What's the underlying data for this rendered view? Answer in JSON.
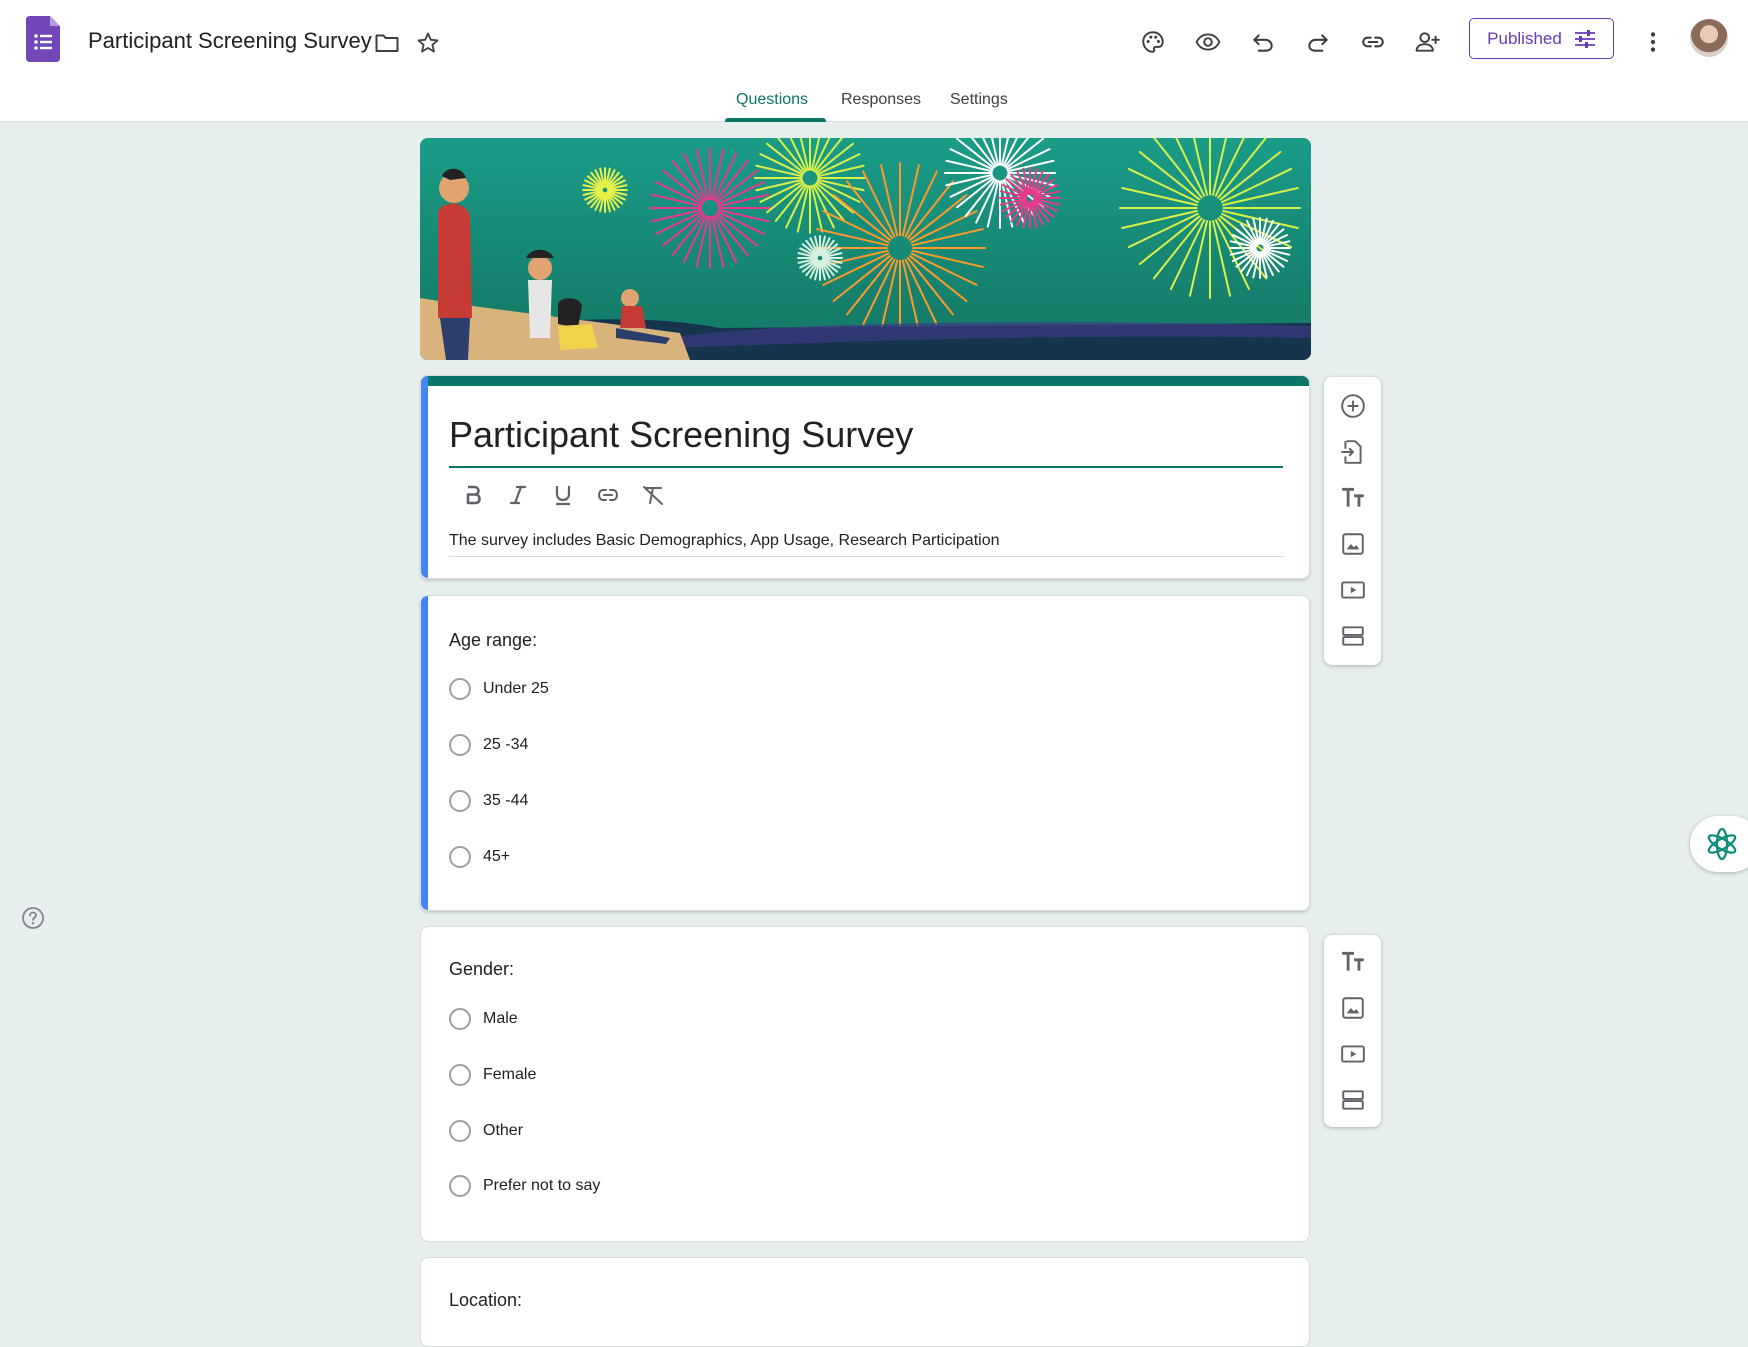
{
  "header": {
    "doc_title": "Participant Screening Survey",
    "publish_label": "Published"
  },
  "tabs": [
    {
      "label": "Questions",
      "active": true
    },
    {
      "label": "Responses",
      "active": false
    },
    {
      "label": "Settings",
      "active": false
    }
  ],
  "form": {
    "title": "Participant Screening Survey",
    "description": "The survey includes Basic Demographics, App Usage, Research Participation"
  },
  "questions": [
    {
      "title": "Age range:",
      "options": [
        "Under 25",
        "25 -34",
        "35 -44",
        "45+"
      ]
    },
    {
      "title": "Gender:",
      "options": [
        "Male",
        "Female",
        "Other",
        "Prefer not to say"
      ]
    },
    {
      "title": "Location:",
      "options": []
    }
  ],
  "colors": {
    "accent": "#0b7668",
    "brand": "#673ab7",
    "focus_bar": "#4285f4",
    "background": "#e6efed"
  },
  "icons": {
    "toolbar": [
      "palette-icon",
      "preview-eye-icon",
      "undo-icon",
      "redo-icon",
      "link-icon",
      "add-collaborator-icon",
      "more-vert-icon"
    ],
    "formatting": [
      "bold-icon",
      "italic-icon",
      "underline-icon",
      "insert-link-icon",
      "clear-format-icon"
    ],
    "side_toolbar_main": [
      "add-question-icon",
      "import-questions-icon",
      "add-title-icon",
      "add-image-icon",
      "add-video-icon",
      "add-section-icon"
    ],
    "side_toolbar_secondary": [
      "add-title-icon",
      "add-image-icon",
      "add-video-icon",
      "add-section-icon"
    ]
  }
}
